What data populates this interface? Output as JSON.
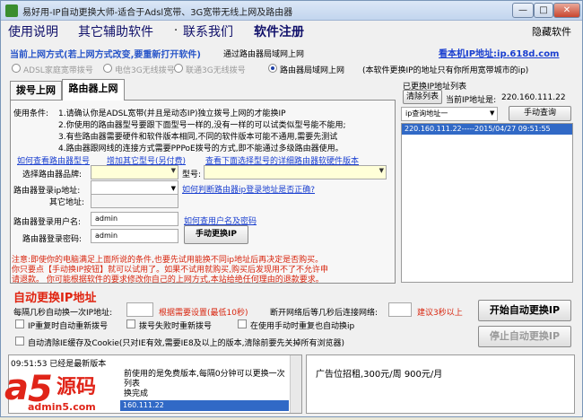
{
  "window": {
    "title": "易好用-IP自动更换大师-适合于Adsl宽带、3G宽带无线上网及路由器",
    "hide_label": "隐藏软件",
    "controls": [
      "—",
      "□",
      "✕"
    ]
  },
  "menu": [
    "使用说明",
    "其它辅助软件",
    "联系我们",
    "软件注册"
  ],
  "connect_mode": {
    "heading": "当前上网方式(若上网方式改变,要重新打开软件)",
    "current": "通过路由器局域网上网",
    "public_ip_link": "看本机IP地址:ip.618d.com",
    "options": [
      "ADSL家庭宽带拨号",
      "电信3G无线拨号",
      "联通3G无线拨号",
      "路由器局域网上网"
    ],
    "note": "(本软件更换IP的地址只有你所用宽带城市的ip)"
  },
  "tabs": [
    "拨号上网",
    "路由器上网"
  ],
  "conditions": {
    "label": "使用条件:",
    "items": [
      "1.请确认你是ADSL宽带(并且是动态IP)独立拨号上网的才能换IP",
      "2.你使用的路由器型号要跟下面型号一样的,没有一样的可以试类似型号能不能用;",
      "3.有些路由器需要硬件和软件版本相同,不同的软件版本可能不通用,需要先测试",
      "4.路由器跟网线的连接方式需要PPPoE拨号的方式,即不能通过多级路由器使用。"
    ]
  },
  "links": {
    "view_model": "如何查看路由器型号",
    "add_model": "增加其它型号(另付费)",
    "model_versions": "查看下面选择型号的详细路由器软硬件版本",
    "judge_ip": "如何判断路由器ip登录地址是否正确?",
    "view_credentials": "如何查用户名及密码"
  },
  "router_form": {
    "brand_label": "选择路由器品牌:",
    "model_label": "型号:",
    "ip_label": "路由器登录ip地址:",
    "other_label": "其它地址:",
    "user_label": "路由器登录用户名:",
    "user_value": "admin",
    "pass_label": "路由器登录密码:",
    "pass_value": "admin",
    "manual_button": "手动更换IP"
  },
  "warning": [
    "注意:即使你的电脑满足上面所说的条件,也要先试用能换不同ip地址后再决定是否购买。",
    "你只要点【手动换IP按钮】就可以试用了。如果不试用就购买,购买后发现用不了不允许申",
    "请退款。 你可能根据软件的要求修改你自己的上网方式,本站给绝任何理由的退款要求。"
  ],
  "auto": {
    "heading": "自动更换IP地址",
    "interval_label": "每隔几秒自动换一次IP地址:",
    "interval_hint": "根据需要设置(最低10秒)",
    "reconnect_label": "断开网络后等几秒后连接网络:",
    "reconnect_hint": "建议3秒以上",
    "options": [
      "IP重复时自动重新拨号",
      "拨号失败时重新拨号",
      "在使用手动时重复也自动换ip",
      "自动清除IE缓存及Cookie(只对IE有效,需要IE8及以上的版本,清除前要先关掉所有浏览器)"
    ],
    "start_button": "开始自动更换IP",
    "stop_button": "停止自动更换IP"
  },
  "ip_list": {
    "heading": "已更换IP地址列表",
    "clear_button": "清除列表",
    "current_label": "当前IP地址是:",
    "current_ip": "220.160.111.22",
    "query_select": "ip查询地址一",
    "query_button": "手动查询",
    "entries": [
      "220.160.111.22-----2015/04/27 09:51:55"
    ]
  },
  "log": {
    "lines": [
      "09:51:53 已经是最新版本",
      "前使用的是免费版本,每隔0分钟可以更换一次",
      "列表",
      "换完成",
      "160.111.22"
    ]
  },
  "ad": {
    "text": "广告位招租,300元/周 900元/月"
  },
  "watermark": {
    "brand": "源码",
    "site": "admin5.com"
  }
}
